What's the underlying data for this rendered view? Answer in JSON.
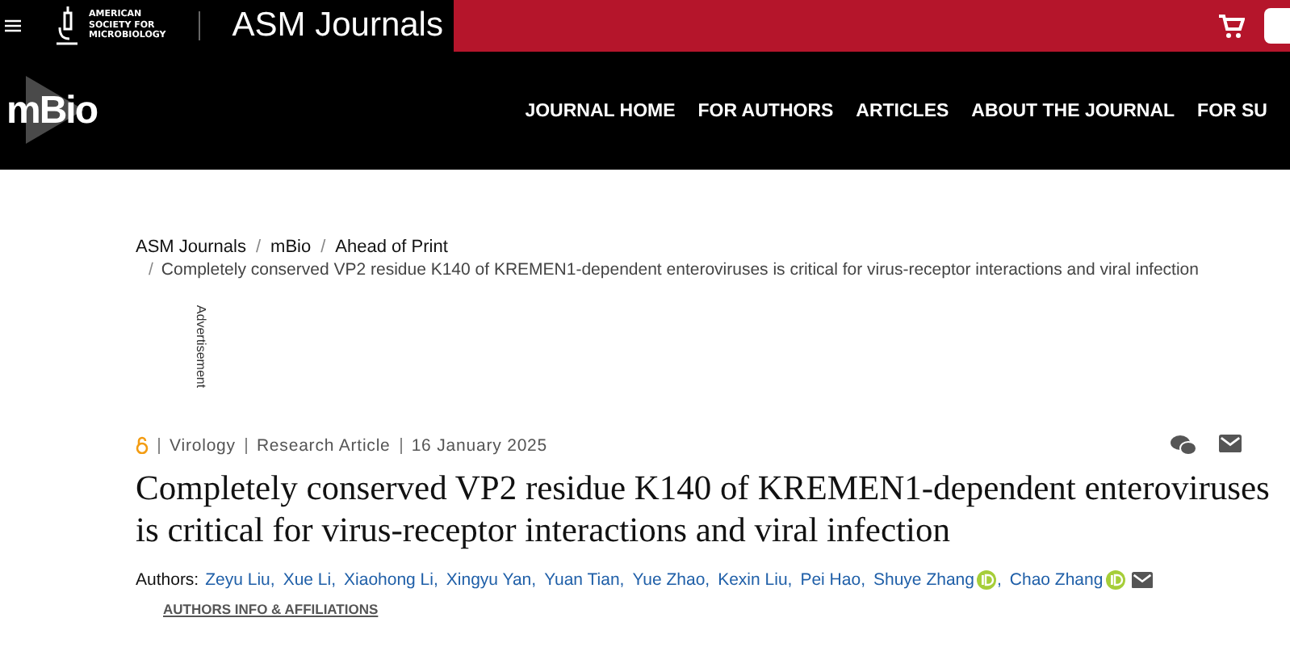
{
  "header": {
    "society": [
      "AMERICAN",
      "SOCIETY FOR",
      "MICROBIOLOGY"
    ],
    "brand": "ASM Journals"
  },
  "journal": {
    "logo": "mBio"
  },
  "nav": [
    "JOURNAL HOME",
    "FOR AUTHORS",
    "ARTICLES",
    "ABOUT THE JOURNAL",
    "FOR SU"
  ],
  "breadcrumb": [
    {
      "text": "ASM Journals"
    },
    {
      "sep": "/",
      "text": "mBio"
    },
    {
      "sep": "/",
      "text": "Ahead of Print"
    }
  ],
  "breadcrumb_current_sep": "/",
  "breadcrumb_current": "Completely conserved VP2 residue K140 of KREMEN1-dependent enteroviruses is critical for virus-receptor interactions and viral infection",
  "advertisement": "Advertisement",
  "meta": [
    "Virology",
    "Research Article",
    "16 January 2025"
  ],
  "title": "Completely conserved VP2 residue K140 of KREMEN1-dependent enteroviruses is critical for virus-receptor interactions and viral infection",
  "authors_label": "Authors:",
  "authors": [
    {
      "name": "Zeyu Liu",
      "orcid": false,
      "suffix": ","
    },
    {
      "name": "Xue Li",
      "orcid": false,
      "suffix": ","
    },
    {
      "name": "Xiaohong Li",
      "orcid": false,
      "suffix": ","
    },
    {
      "name": "Xingyu Yan",
      "orcid": false,
      "suffix": ","
    },
    {
      "name": "Yuan Tian",
      "orcid": false,
      "suffix": ","
    },
    {
      "name": "Yue Zhao",
      "orcid": false,
      "suffix": ","
    },
    {
      "name": "Kexin Liu",
      "orcid": false,
      "suffix": ","
    },
    {
      "name": "Pei Hao",
      "orcid": false,
      "suffix": ","
    },
    {
      "name": "Shuye Zhang",
      "orcid": true,
      "suffix": ","
    },
    {
      "name": "Chao Zhang",
      "orcid": true
    }
  ],
  "authors_info": "AUTHORS INFO & AFFILIATIONS"
}
